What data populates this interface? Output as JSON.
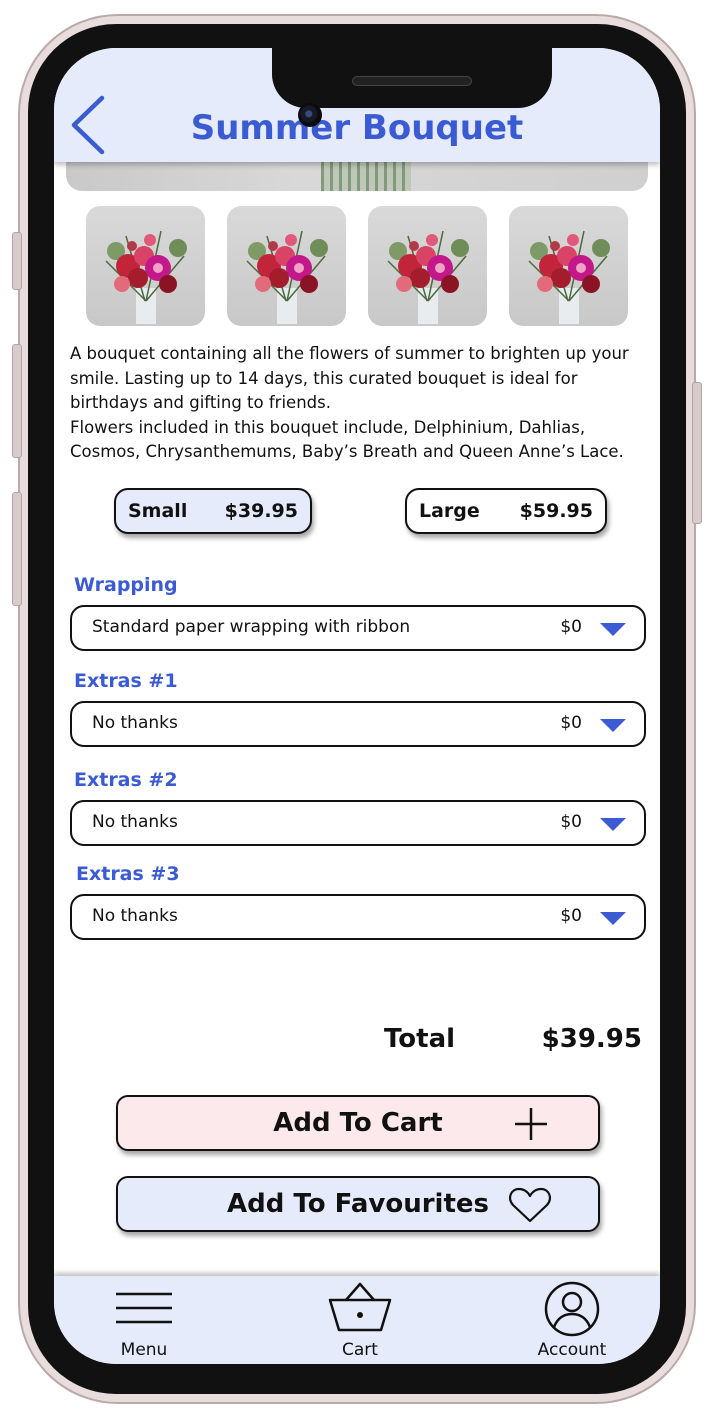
{
  "header": {
    "title": "Summer Bouquet"
  },
  "description": {
    "line1": "A bouquet containing all the flowers of summer to brighten up your smile. Lasting up to 14 days, this curated bouquet is ideal for birthdays and gifting to friends.",
    "line2": "Flowers included in this bouquet include, Delphinium, Dahlias, Cosmos, Chrysanthemums, Baby’s Breath and Queen Anne’s Lace."
  },
  "sizes": [
    {
      "label": "Small",
      "price": "$39.95",
      "selected": true
    },
    {
      "label": "Large",
      "price": "$59.95",
      "selected": false
    }
  ],
  "options": [
    {
      "label": "Wrapping",
      "value": "Standard paper wrapping with ribbon",
      "price": "$0"
    },
    {
      "label": "Extras #1",
      "value": "No thanks",
      "price": "$0"
    },
    {
      "label": "Extras #2",
      "value": "No thanks",
      "price": "$0"
    },
    {
      "label": "Extras #3",
      "value": "No thanks",
      "price": "$0"
    }
  ],
  "total": {
    "label": "Total",
    "value": "$39.95"
  },
  "actions": {
    "add_to_cart": "Add To Cart",
    "add_to_favourites": "Add To Favourites"
  },
  "nav": {
    "menu": "Menu",
    "cart": "Cart",
    "account": "Account"
  },
  "colors": {
    "accent": "#3b5bd2",
    "header_bg": "#e6ebfc",
    "cart_button_bg": "#fbe9ec"
  },
  "icons": [
    "back-chevron-icon",
    "plus-icon",
    "heart-icon",
    "hamburger-menu-icon",
    "basket-icon",
    "user-account-icon",
    "dropdown-arrow-icon"
  ]
}
